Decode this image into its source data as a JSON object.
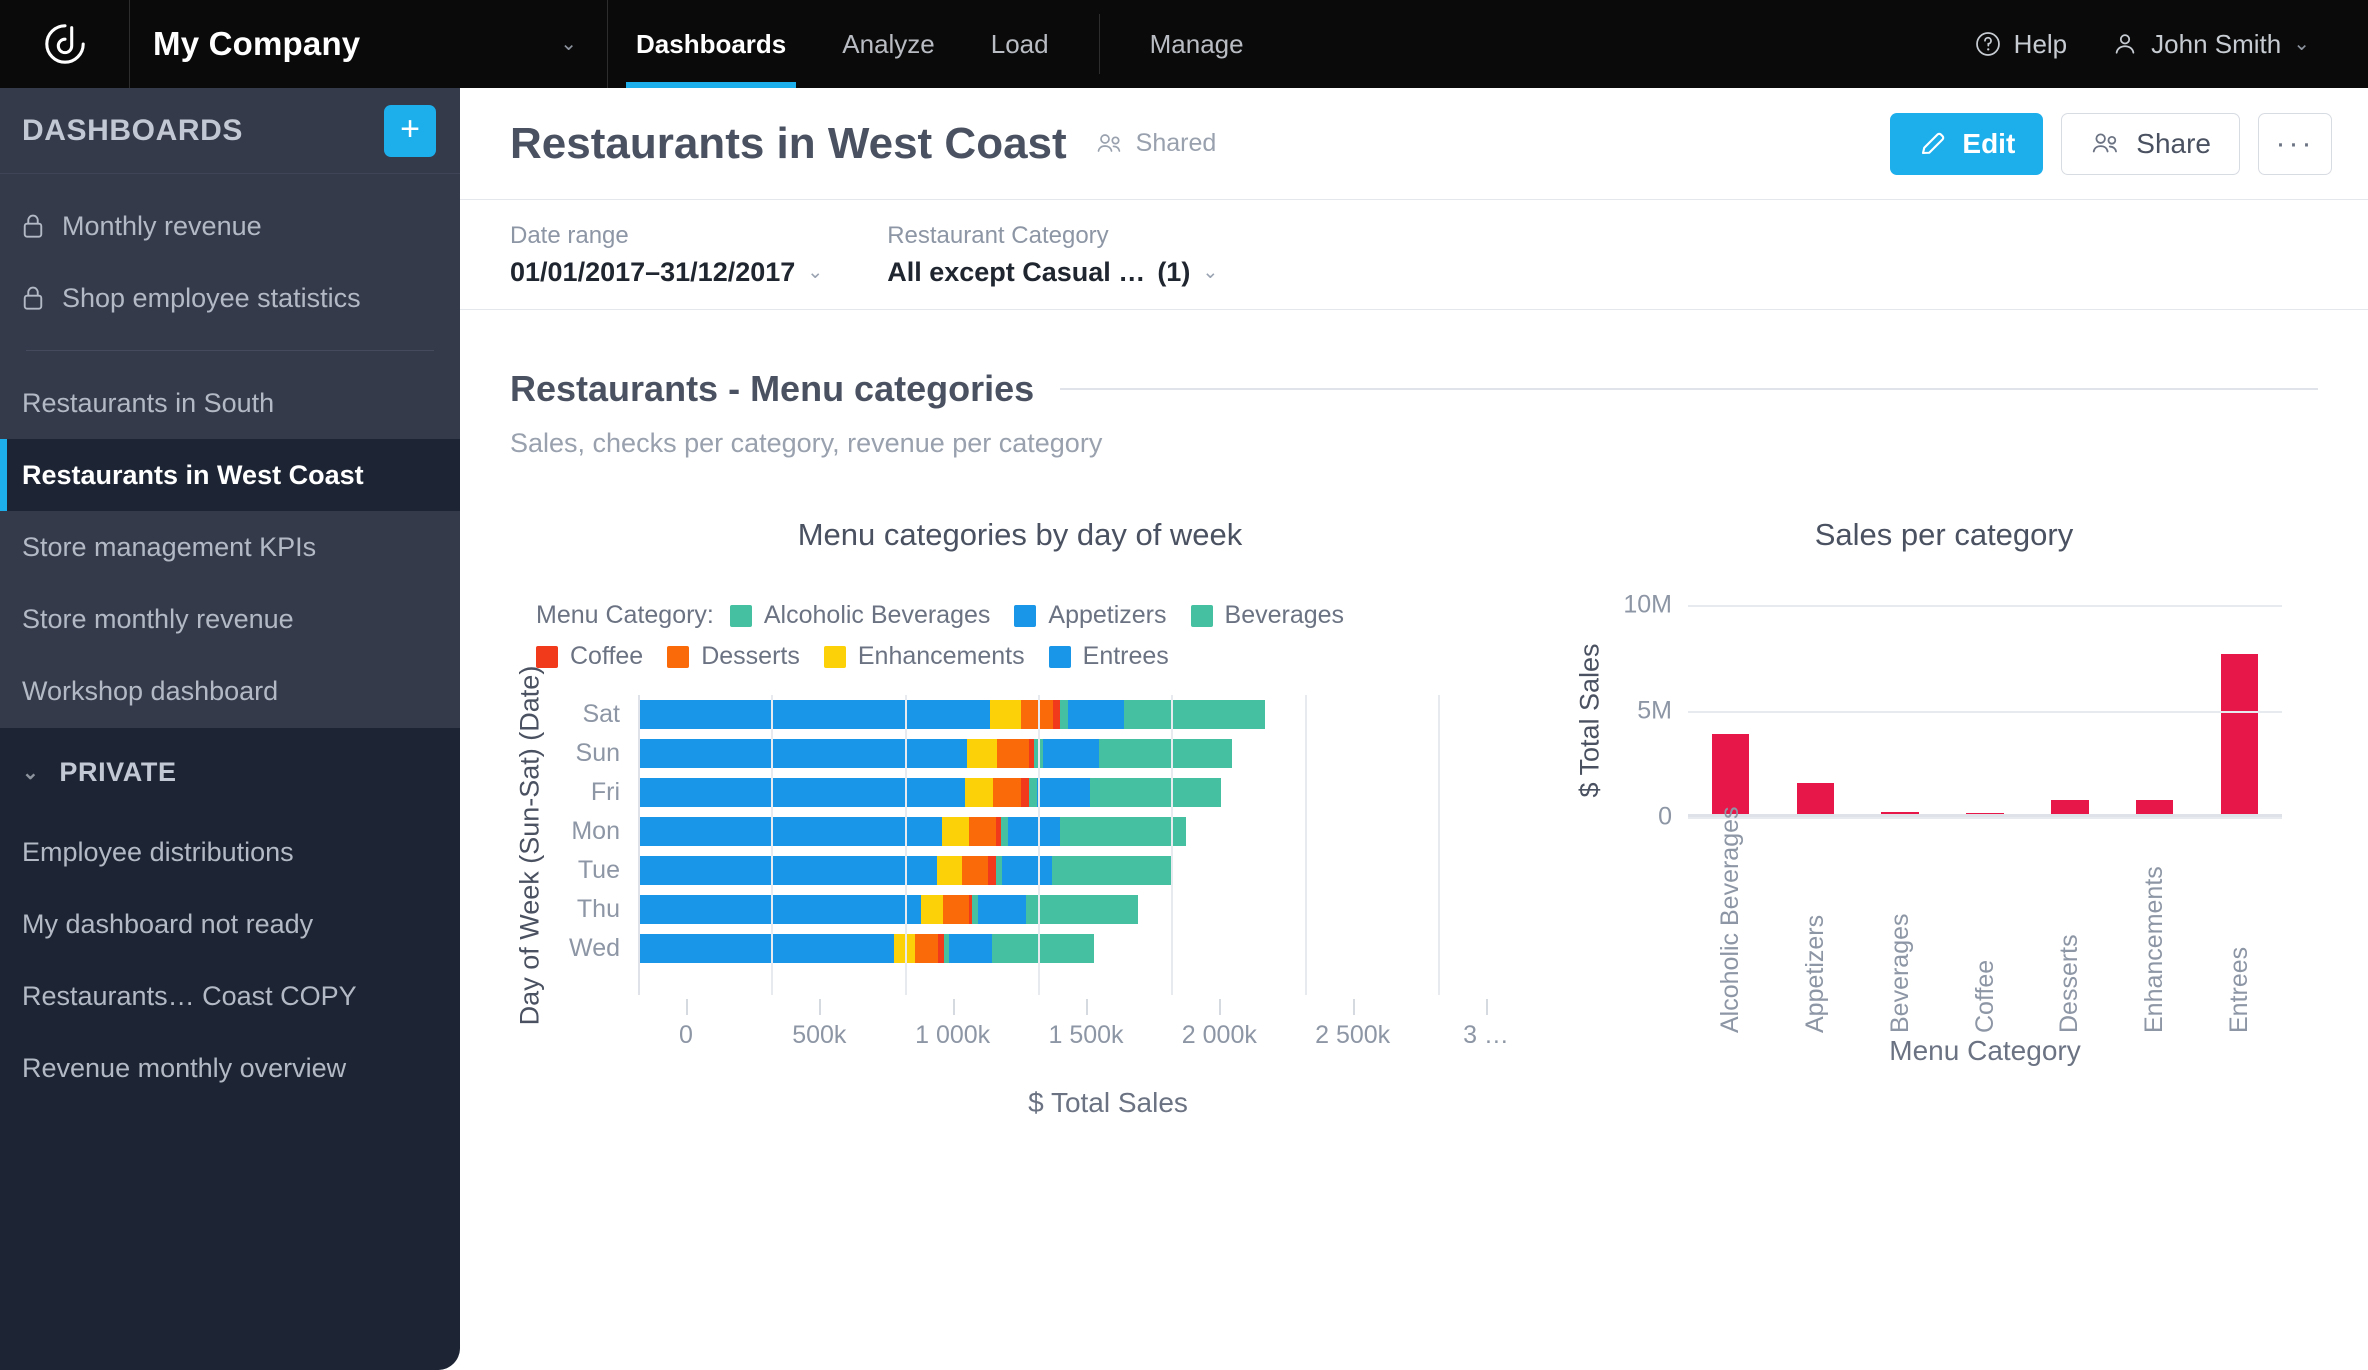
{
  "topnav": {
    "logo_icon": "clarity-logo-icon",
    "company": "My Company",
    "company_caret": "⌄",
    "tabs": [
      {
        "label": "Dashboards",
        "active": true
      },
      {
        "label": "Analyze",
        "active": false
      },
      {
        "label": "Load",
        "active": false
      },
      {
        "label": "Manage",
        "active": false
      }
    ],
    "help": {
      "icon": "help-circle-icon",
      "label": "Help"
    },
    "user": {
      "icon": "user-icon",
      "label": "John Smith",
      "caret": "⌄"
    }
  },
  "sidebar": {
    "title": "DASHBOARDS",
    "add_label": "+",
    "items_top": [
      {
        "label": "Monthly revenue",
        "locked": true,
        "selected": false
      },
      {
        "label": "Shop employee statistics",
        "locked": true,
        "selected": false
      }
    ],
    "items_main": [
      {
        "label": "Restaurants in South",
        "selected": false
      },
      {
        "label": "Restaurants in West Coast",
        "selected": true
      },
      {
        "label": "Store management KPIs",
        "selected": false
      },
      {
        "label": "Store monthly revenue",
        "selected": false
      },
      {
        "label": "Workshop dashboard",
        "selected": false
      }
    ],
    "private": {
      "caret": "⌄",
      "title": "PRIVATE",
      "items": [
        {
          "label": "Employee distributions"
        },
        {
          "label": "My dashboard not ready"
        },
        {
          "label": "Restaurants… Coast COPY"
        },
        {
          "label": "Revenue monthly overview"
        }
      ]
    }
  },
  "page": {
    "title": "Restaurants in West Coast",
    "shared_label": "Shared",
    "shared_icon": "people-icon",
    "actions": {
      "edit": {
        "label": "Edit",
        "icon": "pencil-icon"
      },
      "share": {
        "label": "Share",
        "icon": "people-icon"
      },
      "more": {
        "label": "···",
        "icon": "ellipsis-icon"
      }
    }
  },
  "filters": [
    {
      "label": "Date range",
      "value": "01/01/2017–31/12/2017",
      "count": "",
      "caret": "⌄"
    },
    {
      "label": "Restaurant Category",
      "value": "All except Casual …",
      "count": "(1)",
      "caret": "⌄"
    }
  ],
  "section": {
    "title": "Restaurants - Menu categories",
    "subtitle": "Sales, checks per category, revenue per category"
  },
  "colors": {
    "accent": "#1daeec",
    "crimson": "#e8174a",
    "teal": "#45c0a0",
    "blue": "#1a96e8",
    "red": "#f13a1b",
    "orange": "#fb6a08",
    "yellow": "#fcd108",
    "sidebar_bg": "#343a4a",
    "sidebar_dark": "#1d2433"
  },
  "chart_data": [
    {
      "type": "bar",
      "orientation": "horizontal",
      "stacked": true,
      "title": "Menu categories by day of week",
      "xlabel": "$ Total Sales",
      "ylabel": "Day of Week (Sun-Sat) (Date)",
      "legend_label": "Menu Category:",
      "legend_position": "top-left",
      "grid": true,
      "xlim": [
        0,
        3000000
      ],
      "xticks": [
        0,
        500000,
        1000000,
        1500000,
        2000000,
        2500000,
        3000000
      ],
      "xticklabels": [
        "0",
        "500k",
        "1 000k",
        "1 500k",
        "2 000k",
        "2 500k",
        "3 …"
      ],
      "categories": [
        "Sat",
        "Sun",
        "Fri",
        "Mon",
        "Tue",
        "Thu",
        "Wed"
      ],
      "series": [
        {
          "name": "Entrees",
          "color": "#1a96e8",
          "values": [
            1320000,
            1235000,
            1225000,
            1140000,
            1120000,
            1060000,
            960000
          ]
        },
        {
          "name": "Enhancements",
          "color": "#fcd108",
          "values": [
            118000,
            112000,
            105000,
            100000,
            96000,
            85000,
            80000
          ]
        },
        {
          "name": "Desserts",
          "color": "#fb6a08",
          "values": [
            118000,
            118000,
            108000,
            103000,
            98000,
            95000,
            85000
          ]
        },
        {
          "name": "Coffee",
          "color": "#f13a1b",
          "values": [
            28000,
            20000,
            30000,
            20000,
            28000,
            14000,
            22000
          ]
        },
        {
          "name": "Beverages",
          "color": "#45c0a0",
          "values": [
            28000,
            32000,
            28000,
            26000,
            22000,
            20000,
            20000
          ]
        },
        {
          "name": "Appetizers",
          "color": "#1a96e8",
          "values": [
            210000,
            210000,
            200000,
            195000,
            190000,
            180000,
            160000
          ]
        },
        {
          "name": "Alcoholic Beverages",
          "color": "#45c0a0",
          "values": [
            530000,
            500000,
            490000,
            470000,
            445000,
            420000,
            385000
          ]
        }
      ],
      "totals": [
        2352000,
        2227000,
        2186000,
        2054000,
        1999000,
        1874000,
        1712000
      ]
    },
    {
      "type": "bar",
      "orientation": "vertical",
      "title": "Sales per category",
      "xlabel": "Menu Category",
      "ylabel": "$ Total Sales",
      "grid": true,
      "ylim": [
        0,
        10000000
      ],
      "yticks": [
        0,
        5000000,
        10000000
      ],
      "yticklabels": [
        "0",
        "5M",
        "10M"
      ],
      "bar_color": "#e8174a",
      "categories": [
        "Alcoholic Beverages",
        "Appetizers",
        "Beverages",
        "Coffee",
        "Desserts",
        "Enhancements",
        "Entrees"
      ],
      "values": [
        3900000,
        1600000,
        250000,
        170000,
        800000,
        790000,
        7700000
      ]
    }
  ]
}
